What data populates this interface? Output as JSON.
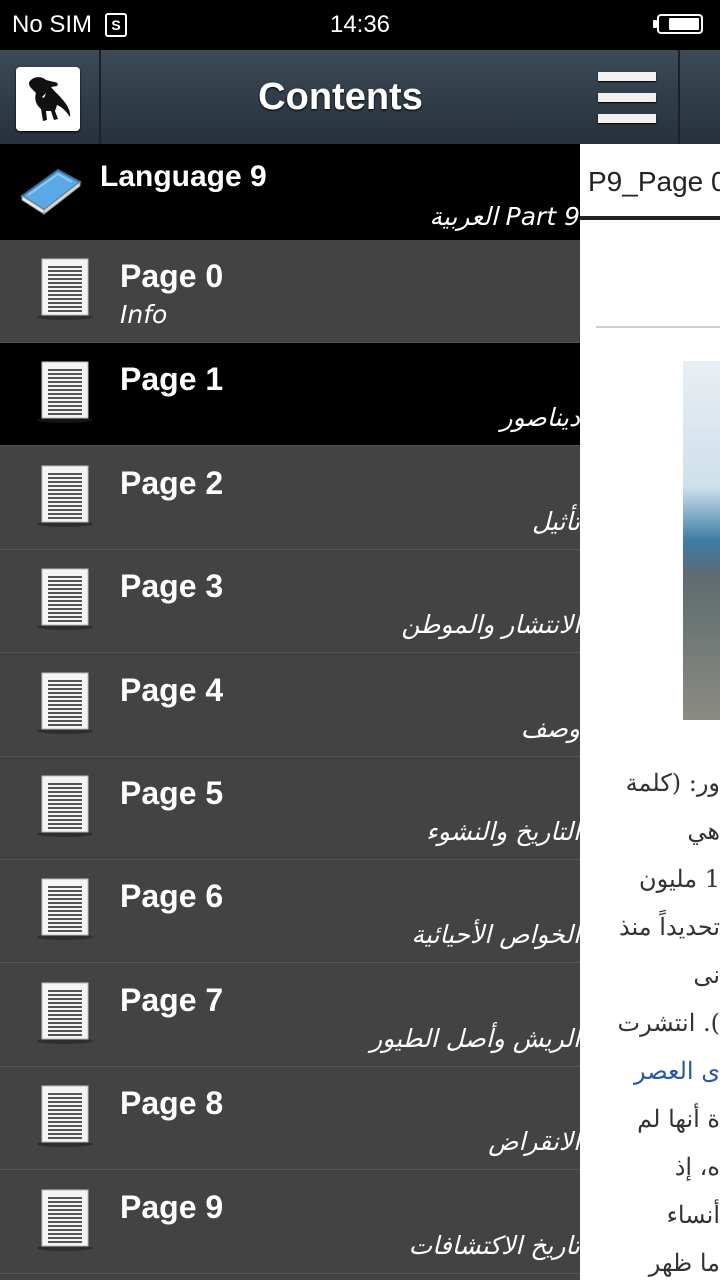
{
  "status_bar": {
    "carrier": "No SIM",
    "sim_glyph": "S",
    "time": "14:36"
  },
  "drawer": {
    "title": "Contents",
    "language": {
      "title": "Language 9",
      "subtitle": "العربية Part 9"
    },
    "pages": [
      {
        "title": "Page 0",
        "subtitle": "Info"
      },
      {
        "title": "Page 1",
        "subtitle": "ديناصور"
      },
      {
        "title": "Page 2",
        "subtitle": "تأثيل"
      },
      {
        "title": "Page 3",
        "subtitle": "الانتشار والموطن"
      },
      {
        "title": "Page 4",
        "subtitle": "وصف"
      },
      {
        "title": "Page 5",
        "subtitle": "التاريخ والنشوء"
      },
      {
        "title": "Page 6",
        "subtitle": "الخواص الأحيائية"
      },
      {
        "title": "Page 7",
        "subtitle": "الريش وأصل الطيور"
      },
      {
        "title": "Page 8",
        "subtitle": "الانقراض"
      },
      {
        "title": "Page 9",
        "subtitle": "تاريخ الاكتشافات"
      }
    ],
    "selected_index": 1
  },
  "background_page": {
    "tab_label": "P9_Page 0",
    "text_lines": [
      {
        "text": "ور: (كلمة",
        "link": false
      },
      {
        "text": "هي",
        "link": false
      },
      {
        "text": "1 مليون",
        "link": false
      },
      {
        "text": "تحديداً منذ",
        "link": false
      },
      {
        "text": "نى",
        "link": false
      },
      {
        "text": "). انتشرت",
        "link": false
      },
      {
        "text": "ى العصر",
        "link": true
      },
      {
        "text": "ة أنها لم",
        "link": false
      },
      {
        "text": "ه، إذ",
        "link": false
      },
      {
        "text": "أنساء",
        "link": false
      },
      {
        "text": "ما ظهر",
        "link": false
      }
    ]
  }
}
